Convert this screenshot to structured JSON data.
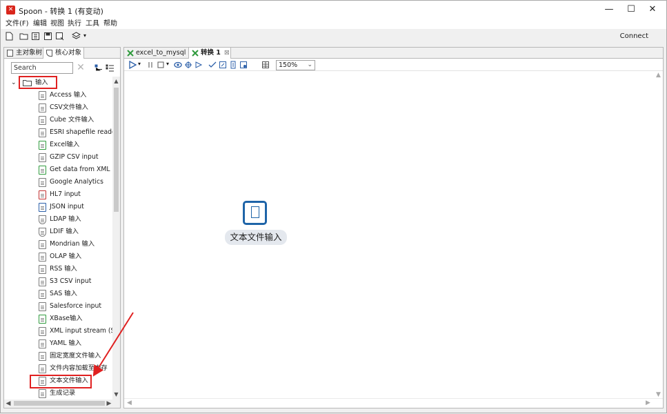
{
  "window": {
    "title": "Spoon - 转换 1 (有变动)",
    "app_icon_glyph": "✕",
    "controls": {
      "minimize": "—",
      "maximize": "☐",
      "close": "✕"
    }
  },
  "menu": [
    "文件(F)",
    "编辑",
    "视图",
    "执行",
    "工具",
    "帮助"
  ],
  "toolbar": {
    "connect_label": "Connect"
  },
  "left_panel": {
    "tabs": [
      {
        "label": "主对象树",
        "selected": false
      },
      {
        "label": "核心对象",
        "selected": true
      }
    ],
    "search": {
      "placeholder": "Search",
      "clear": "✕"
    },
    "tree": {
      "root": {
        "label": "输入",
        "expanded": true
      },
      "items": [
        "Access 输入",
        "CSV文件输入",
        "Cube 文件输入",
        "ESRI shapefile reader",
        "Excel输入",
        "GZIP CSV input",
        "Get data from XML",
        "Google Analytics",
        "HL7 input",
        "JSON input",
        "LDAP 输入",
        "LDIF 输入",
        "Mondrian 输入",
        "OLAP 输入",
        "RSS 输入",
        "S3 CSV input",
        "SAS 输入",
        "Salesforce input",
        "XBase输入",
        "XML input stream (StAX)",
        "YAML 输入",
        "固定宽度文件输入",
        "文件内容加载至内存",
        "文本文件输入",
        "生成记录"
      ]
    }
  },
  "editor": {
    "tabs": [
      {
        "label": "excel_to_mysql",
        "selected": false
      },
      {
        "label": "转换 1",
        "selected": true,
        "close": "⊠"
      }
    ],
    "zoom": "150%",
    "canvas": {
      "step": {
        "label": "文本文件输入"
      }
    }
  },
  "colors": {
    "accent": "#1e64a8",
    "annotation": "#e02020",
    "spoon_green": "#2e9a3c"
  }
}
